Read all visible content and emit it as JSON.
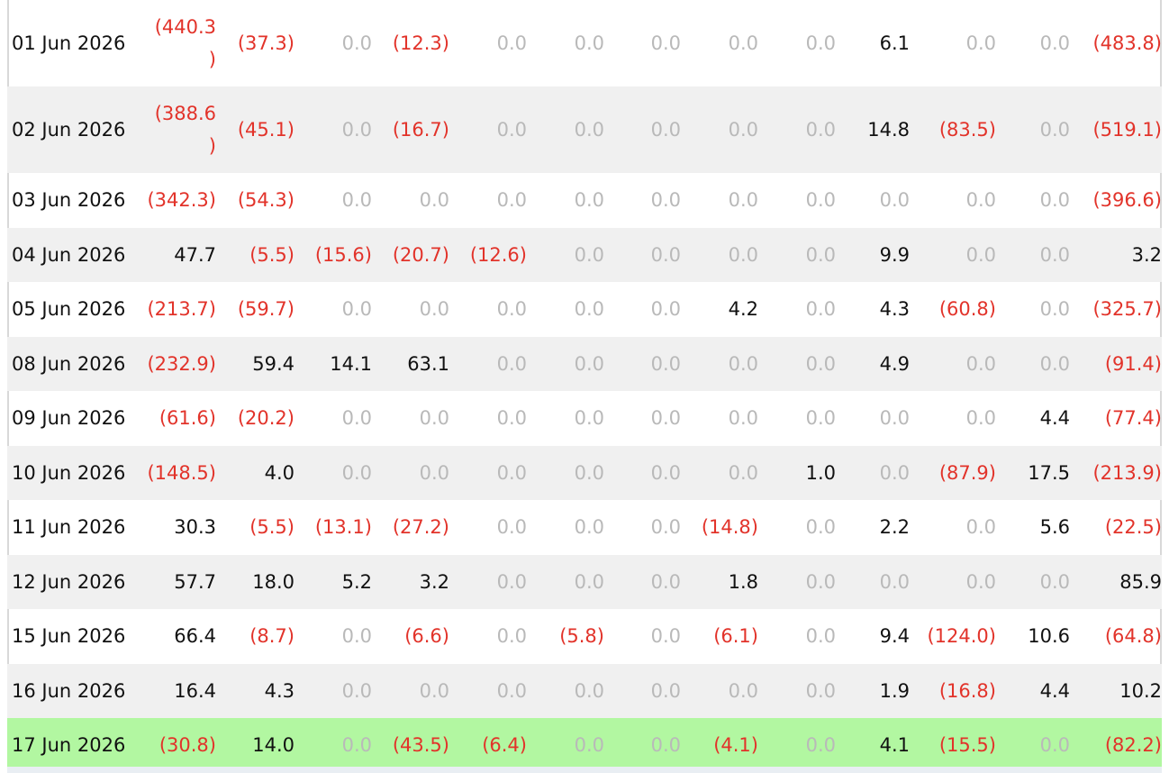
{
  "rows": [
    {
      "date": "01 Jun 2026",
      "cells": [
        "(440.3\n)",
        "(37.3)",
        "0.0",
        "(12.3)",
        "0.0",
        "0.0",
        "0.0",
        "0.0",
        "0.0",
        "6.1",
        "0.0",
        "0.0",
        "(483.8)"
      ],
      "tall": true
    },
    {
      "date": "02 Jun 2026",
      "cells": [
        "(388.6\n)",
        "(45.1)",
        "0.0",
        "(16.7)",
        "0.0",
        "0.0",
        "0.0",
        "0.0",
        "0.0",
        "14.8",
        "(83.5)",
        "0.0",
        "(519.1)"
      ],
      "tall": true
    },
    {
      "date": "03 Jun 2026",
      "cells": [
        "(342.3)",
        "(54.3)",
        "0.0",
        "0.0",
        "0.0",
        "0.0",
        "0.0",
        "0.0",
        "0.0",
        "0.0",
        "0.0",
        "0.0",
        "(396.6)"
      ]
    },
    {
      "date": "04 Jun 2026",
      "cells": [
        "47.7",
        "(5.5)",
        "(15.6)",
        "(20.7)",
        "(12.6)",
        "0.0",
        "0.0",
        "0.0",
        "0.0",
        "9.9",
        "0.0",
        "0.0",
        "3.2"
      ]
    },
    {
      "date": "05 Jun 2026",
      "cells": [
        "(213.7)",
        "(59.7)",
        "0.0",
        "0.0",
        "0.0",
        "0.0",
        "0.0",
        "4.2",
        "0.0",
        "4.3",
        "(60.8)",
        "0.0",
        "(325.7)"
      ]
    },
    {
      "date": "08 Jun 2026",
      "cells": [
        "(232.9)",
        "59.4",
        "14.1",
        "63.1",
        "0.0",
        "0.0",
        "0.0",
        "0.0",
        "0.0",
        "4.9",
        "0.0",
        "0.0",
        "(91.4)"
      ]
    },
    {
      "date": "09 Jun 2026",
      "cells": [
        "(61.6)",
        "(20.2)",
        "0.0",
        "0.0",
        "0.0",
        "0.0",
        "0.0",
        "0.0",
        "0.0",
        "0.0",
        "0.0",
        "4.4",
        "(77.4)"
      ]
    },
    {
      "date": "10 Jun 2026",
      "cells": [
        "(148.5)",
        "4.0",
        "0.0",
        "0.0",
        "0.0",
        "0.0",
        "0.0",
        "0.0",
        "1.0",
        "0.0",
        "(87.9)",
        "17.5",
        "(213.9)"
      ]
    },
    {
      "date": "11 Jun 2026",
      "cells": [
        "30.3",
        "(5.5)",
        "(13.1)",
        "(27.2)",
        "0.0",
        "0.0",
        "0.0",
        "(14.8)",
        "0.0",
        "2.2",
        "0.0",
        "5.6",
        "(22.5)"
      ]
    },
    {
      "date": "12 Jun 2026",
      "cells": [
        "57.7",
        "18.0",
        "5.2",
        "3.2",
        "0.0",
        "0.0",
        "0.0",
        "1.8",
        "0.0",
        "0.0",
        "0.0",
        "0.0",
        "85.9"
      ]
    },
    {
      "date": "15 Jun 2026",
      "cells": [
        "66.4",
        "(8.7)",
        "0.0",
        "(6.6)",
        "0.0",
        "(5.8)",
        "0.0",
        "(6.1)",
        "0.0",
        "9.4",
        "(124.0)",
        "10.6",
        "(64.8)"
      ]
    },
    {
      "date": "16 Jun 2026",
      "cells": [
        "16.4",
        "4.3",
        "0.0",
        "0.0",
        "0.0",
        "0.0",
        "0.0",
        "0.0",
        "0.0",
        "1.9",
        "(16.8)",
        "4.4",
        "10.2"
      ]
    },
    {
      "date": "17 Jun 2026",
      "cells": [
        "(30.8)",
        "14.0",
        "0.0",
        "(43.5)",
        "(6.4)",
        "0.0",
        "0.0",
        "(4.1)",
        "0.0",
        "4.1",
        "(15.5)",
        "0.0",
        "(82.2)"
      ],
      "highlight": true
    }
  ],
  "colors": {
    "negative": "#e2332a",
    "zero": "#b9b9b9",
    "positive": "#111111",
    "highlight": "#b2f7a1",
    "alt_row": "#f0f0f0"
  }
}
